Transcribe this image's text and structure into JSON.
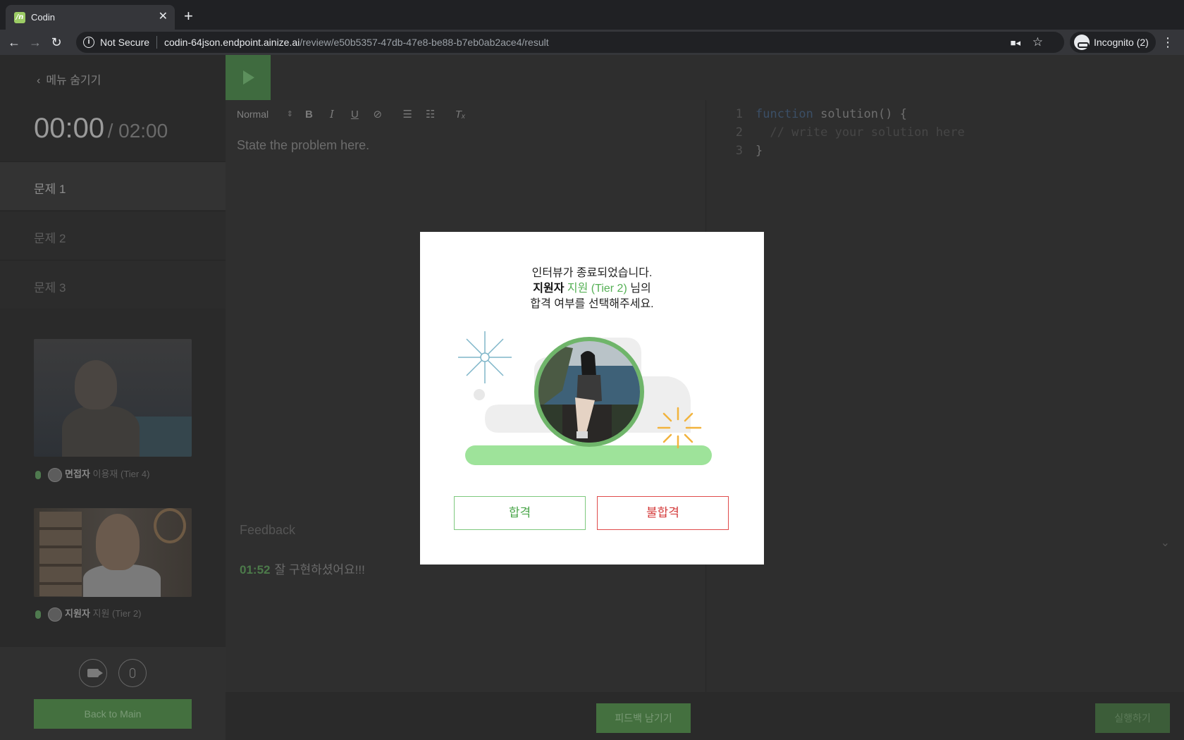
{
  "browser": {
    "tab_title": "Codin",
    "tab_favicon_text": "/n",
    "not_secure": "Not Secure",
    "url_host": "codin-64json.endpoint.ainize.ai",
    "url_path": "/review/e50b5357-47db-47e8-be88-b7eb0ab2ace4/result",
    "incognito_label": "Incognito (2)"
  },
  "sidebar": {
    "menu_hide": "메뉴 숨기기",
    "timer_elapsed": "00:00",
    "timer_total": "/ 02:00",
    "problems": [
      "문제 1",
      "문제 2",
      "문제 3"
    ],
    "participants": [
      {
        "role": "면접자",
        "name": "이용재 (Tier 4)"
      },
      {
        "role": "지원자",
        "name": "지원 (Tier 2)"
      }
    ],
    "back_button": "Back to Main"
  },
  "editor": {
    "format_select": "Normal",
    "toolbar_glyphs": {
      "bold": "B",
      "italic": "I",
      "underline": "U"
    },
    "placeholder": "State the problem here.",
    "feedback_title": "Feedback",
    "feedback_entries": [
      {
        "time": "01:52",
        "text": "잘 구현하셨어요!!!"
      }
    ]
  },
  "code": {
    "lines": [
      {
        "num": "1",
        "keyword": "function",
        "text": " solution() {"
      },
      {
        "num": "2",
        "comment": "  // write your solution here"
      },
      {
        "num": "3",
        "text": "}"
      }
    ]
  },
  "bottom": {
    "feedback_button": "피드백 남기기",
    "execute_button": "실행하기"
  },
  "modal": {
    "line1": "인터뷰가 종료되었습니다.",
    "role": "지원자",
    "name": "지원 (Tier 2)",
    "line2_suffix": "님의",
    "line3": "합격 여부를 선택해주세요.",
    "pass_button": "합격",
    "fail_button": "불합격"
  },
  "colors": {
    "accent_green": "#55b055",
    "fail_red": "#d43a3a",
    "overlay_bg": "#303030"
  }
}
